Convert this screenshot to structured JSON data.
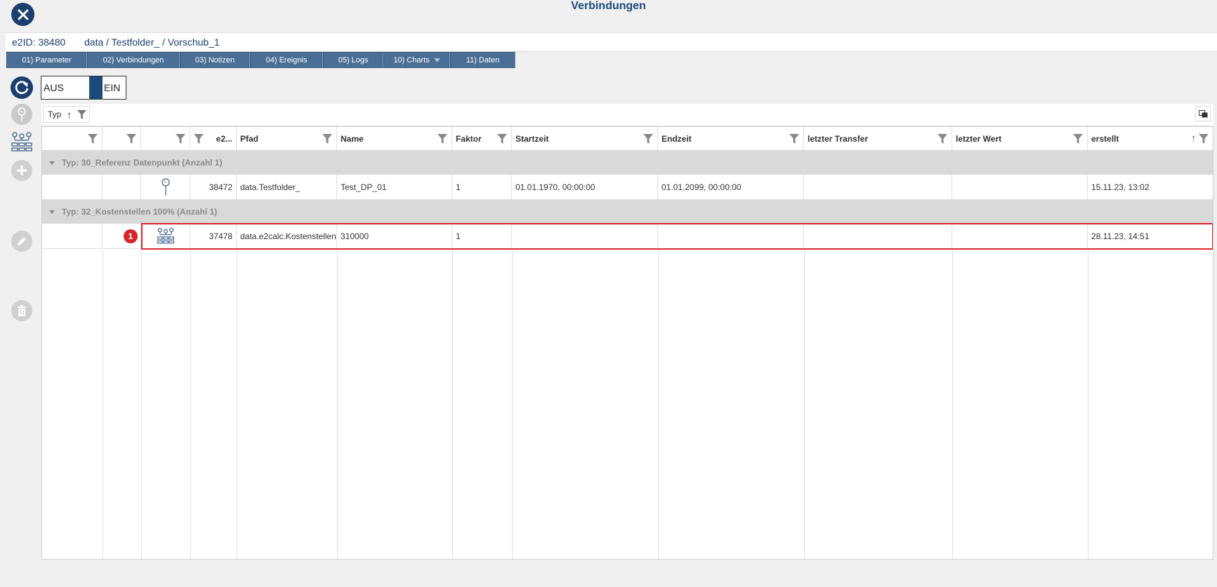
{
  "window": {
    "title": "Verbindungen"
  },
  "info": {
    "e2id": "e2ID: 38480",
    "path": "data / Testfolder_ / Vorschub_1"
  },
  "tabs": [
    {
      "label": "01) Parameter"
    },
    {
      "label": "02) Verbindungen"
    },
    {
      "label": "03) Notizen"
    },
    {
      "label": "04) Ereignis"
    },
    {
      "label": "05) Logs"
    },
    {
      "label": "10) Charts",
      "has_dropdown": true
    },
    {
      "label": "11) Daten"
    }
  ],
  "toggle": {
    "off_label": "AUS",
    "on_label": "EIN",
    "state": "EIN"
  },
  "side_icons": [
    "refresh-icon",
    "pin-icon",
    "network-icon",
    "add-icon",
    "edit-icon",
    "delete-icon"
  ],
  "group_chip": {
    "label": "Typ",
    "sort": "↑"
  },
  "columns": [
    {
      "label": ""
    },
    {
      "label": ""
    },
    {
      "label": ""
    },
    {
      "label": "e2..."
    },
    {
      "label": "Pfad"
    },
    {
      "label": "Name"
    },
    {
      "label": "Faktor"
    },
    {
      "label": "Startzeit"
    },
    {
      "label": "Endzeit"
    },
    {
      "label": "letzter Transfer"
    },
    {
      "label": "letzter Wert"
    },
    {
      "label": "erstellt",
      "sort": "↑"
    }
  ],
  "groups": [
    {
      "label": "Typ: 30_Referenz Datenpunkt (Anzahl 1)",
      "rows": [
        {
          "icon": "pin-icon",
          "id": "38472",
          "pfad": "data.Testfolder_",
          "name": "Test_DP_01",
          "faktor": "1",
          "startzeit": "01.01.1970, 00:00:00",
          "endzeit": "01.01.2099, 00:00:00",
          "transfer": "",
          "wert": "",
          "erstellt": "15.11.23, 13:02"
        }
      ]
    },
    {
      "label": "Typ: 32_Kostenstellen 100% (Anzahl 1)",
      "rows": [
        {
          "badge": "1",
          "icon": "network-icon",
          "id": "37478",
          "pfad": "data.e2calc.Kostenstellen",
          "name": "310000",
          "faktor": "1",
          "startzeit": "",
          "endzeit": "",
          "transfer": "",
          "wert": "",
          "erstellt": "28.11.23, 14:51",
          "highlighted": true
        }
      ]
    }
  ],
  "colors": {
    "primary": "#1b3f6e",
    "tab": "#4a6f97",
    "highlight": "#e0262b",
    "badge": "#d9232b"
  }
}
